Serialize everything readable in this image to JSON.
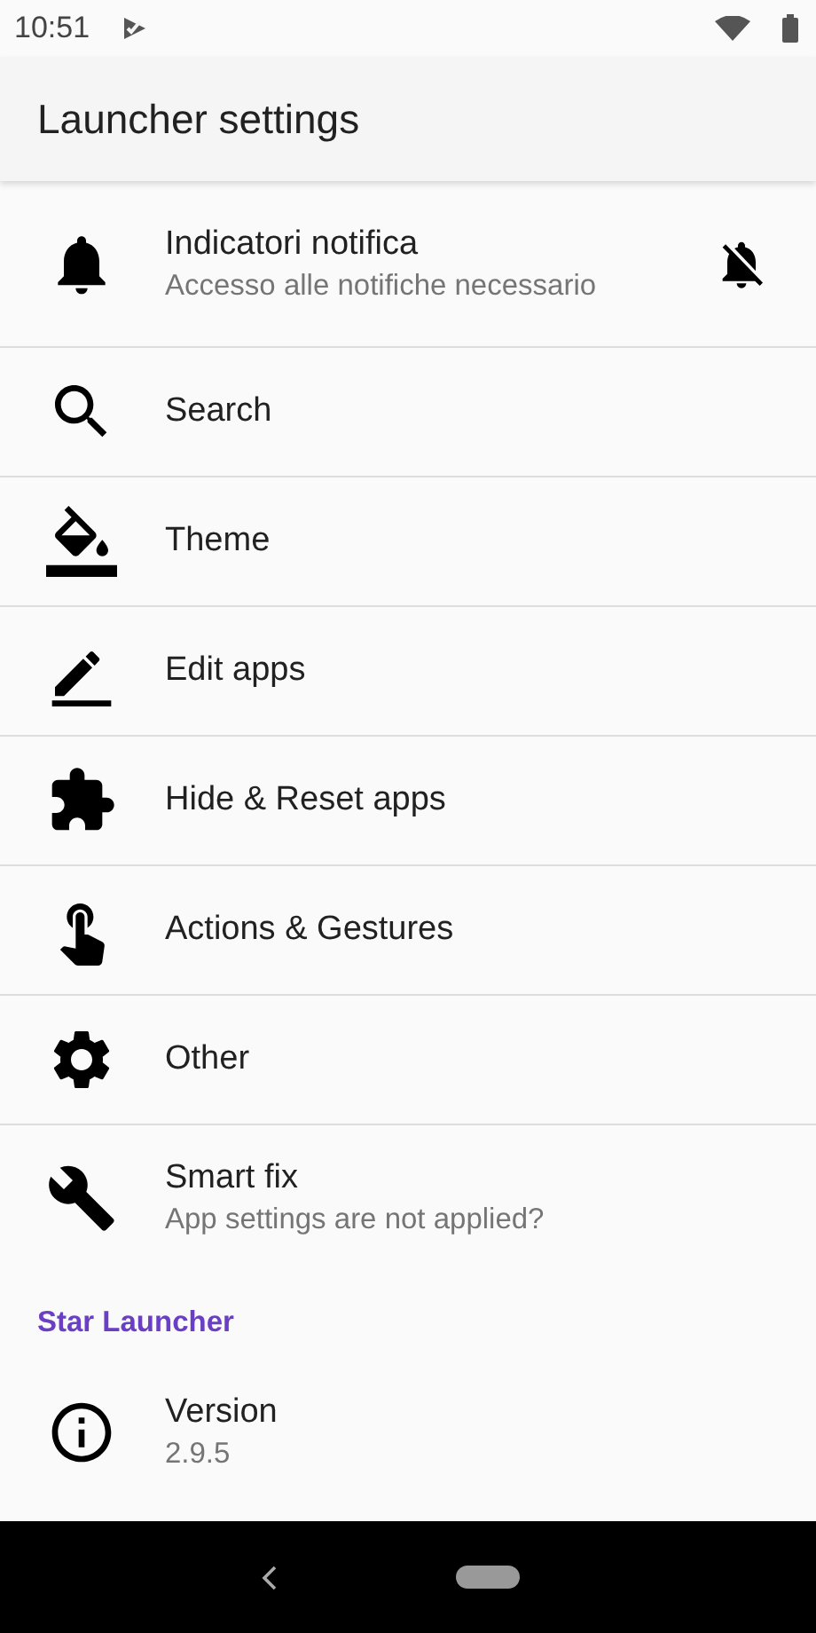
{
  "status_bar": {
    "time": "10:51"
  },
  "app_bar": {
    "title": "Launcher settings"
  },
  "settings": [
    {
      "title": "Indicatori notifica",
      "subtitle": "Accesso alle notifiche necessario"
    },
    {
      "title": "Search"
    },
    {
      "title": "Theme"
    },
    {
      "title": "Edit apps"
    },
    {
      "title": "Hide & Reset apps"
    },
    {
      "title": "Actions & Gestures"
    },
    {
      "title": "Other"
    },
    {
      "title": "Smart fix",
      "subtitle": "App settings are not applied?"
    }
  ],
  "about": {
    "header": "Star Launcher",
    "items": [
      {
        "title": "Version",
        "subtitle": "2.9.5"
      }
    ]
  }
}
